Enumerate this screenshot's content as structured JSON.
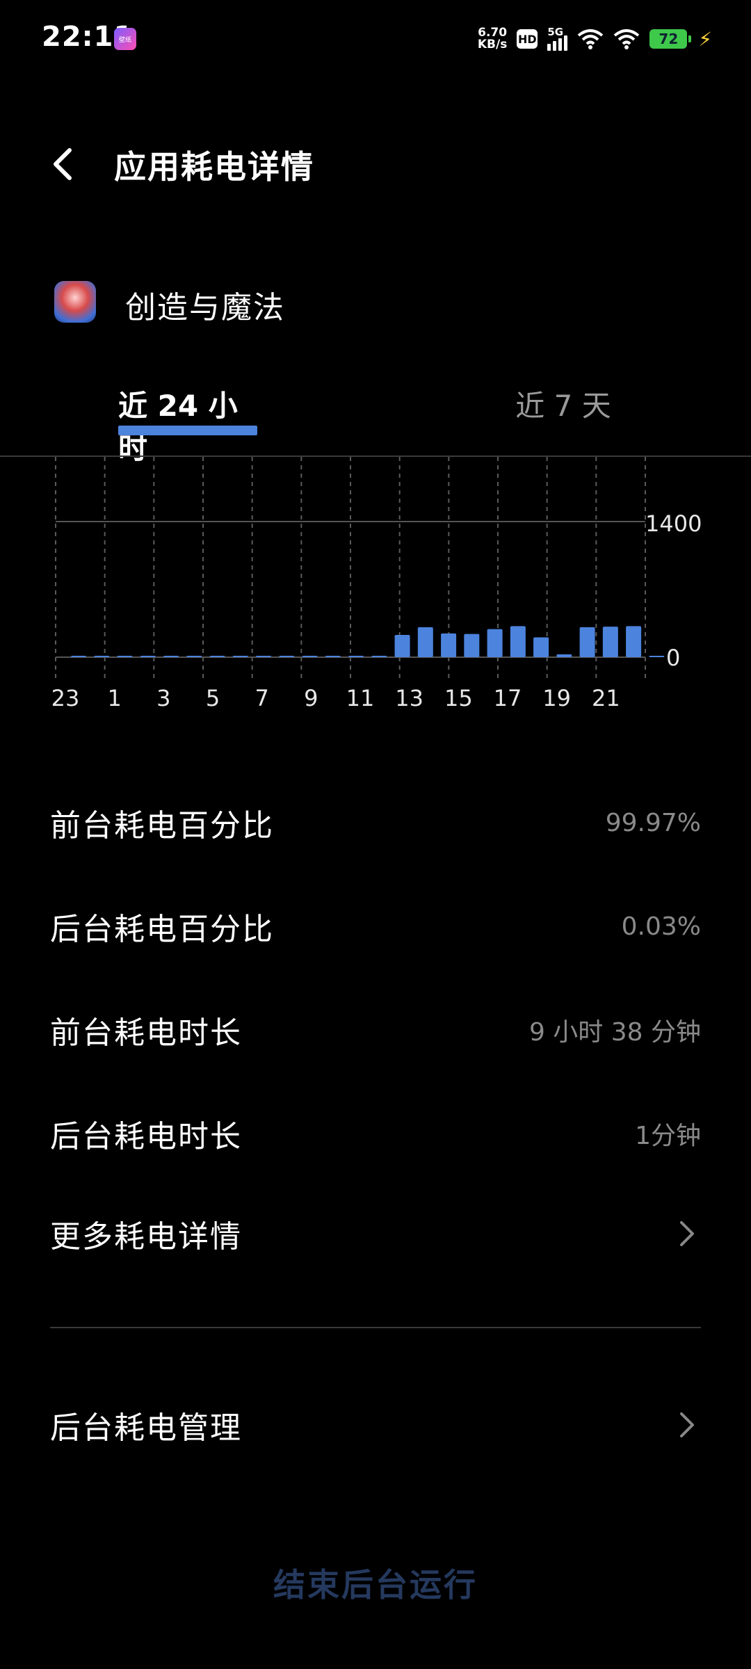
{
  "statusbar": {
    "time": "22:11",
    "app_badge": "壁纸",
    "speed_value": "6.70",
    "speed_unit": "KB/s",
    "hd": "HD",
    "network": "5G",
    "battery": "72"
  },
  "header": {
    "title": "应用耗电详情"
  },
  "app": {
    "name": "创造与魔法"
  },
  "tabs": [
    {
      "label": "近 24 小时",
      "selected": true
    },
    {
      "label": "近 7 天",
      "selected": false
    }
  ],
  "chart_data": {
    "type": "bar",
    "categories": [
      "23",
      "0",
      "1",
      "2",
      "3",
      "4",
      "5",
      "6",
      "7",
      "8",
      "9",
      "10",
      "11",
      "12",
      "13",
      "14",
      "15",
      "16",
      "17",
      "18",
      "19",
      "20",
      "21",
      "22"
    ],
    "x_tick_labels": [
      "23",
      "1",
      "3",
      "5",
      "7",
      "9",
      "11",
      "13",
      "15",
      "17",
      "19",
      "21"
    ],
    "values": [
      0,
      5,
      5,
      5,
      0,
      0,
      0,
      0,
      0,
      0,
      0,
      0,
      0,
      0,
      230,
      310,
      245,
      240,
      290,
      320,
      205,
      30,
      310,
      315,
      320,
      10
    ],
    "y_tick_labels": [
      "1400",
      "0"
    ],
    "ylim": [
      0,
      1400
    ],
    "bar_color": "#4c83dd"
  },
  "stats": [
    {
      "label": "前台耗电百分比",
      "value": "99.97%"
    },
    {
      "label": "后台耗电百分比",
      "value": "0.03%"
    },
    {
      "label": "前台耗电时长",
      "value": "9 小时 38 分钟"
    },
    {
      "label": "后台耗电时长",
      "value": "1分钟"
    }
  ],
  "more_details": "更多耗电详情",
  "background_management": "后台耗电管理",
  "end_background": "结束后台运行"
}
